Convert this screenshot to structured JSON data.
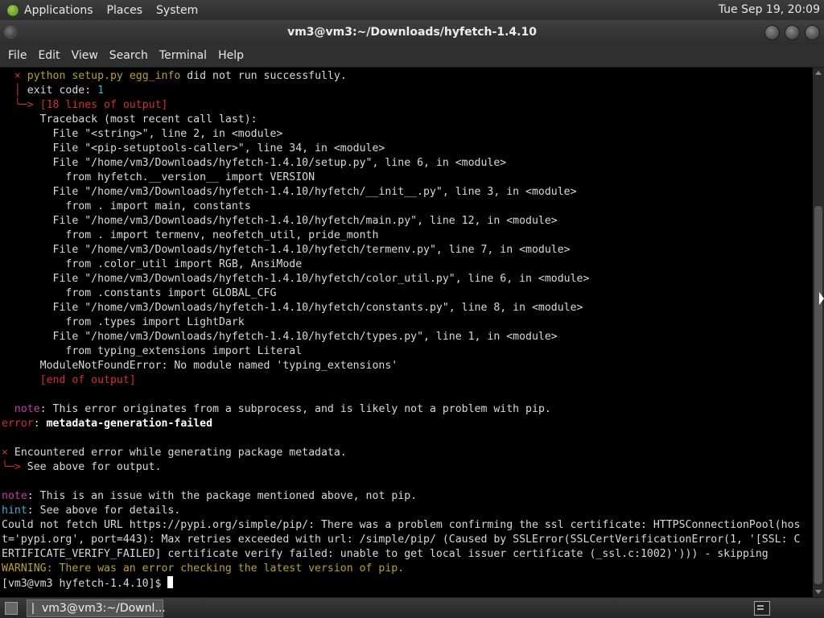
{
  "top_panel": {
    "menus": [
      "Applications",
      "Places",
      "System"
    ],
    "clock": "Tue Sep 19, 20:09"
  },
  "window": {
    "title": "vm3@vm3:~/Downloads/hyfetch-1.4.10"
  },
  "menubar": {
    "items": [
      "File",
      "Edit",
      "View",
      "Search",
      "Terminal",
      "Help"
    ]
  },
  "terminal": {
    "lines": [
      [
        {
          "t": "  "
        },
        {
          "t": "× ",
          "c": "c-red"
        },
        {
          "t": "python setup.py egg_info",
          "c": "c-yel"
        },
        {
          "t": " did not run successfully."
        }
      ],
      [
        {
          "t": "  "
        },
        {
          "t": "│",
          "c": "c-red"
        },
        {
          "t": " exit code: "
        },
        {
          "t": "1",
          "c": "c-cyan"
        }
      ],
      [
        {
          "t": "  "
        },
        {
          "t": "╰─>",
          "c": "c-red"
        },
        {
          "t": " [18 lines of output]",
          "c": "c-red"
        }
      ],
      [
        {
          "t": "      Traceback (most recent call last):"
        }
      ],
      [
        {
          "t": "        File \"<string>\", line 2, in <module>"
        }
      ],
      [
        {
          "t": "        File \"<pip-setuptools-caller>\", line 34, in <module>"
        }
      ],
      [
        {
          "t": "        File \"/home/vm3/Downloads/hyfetch-1.4.10/setup.py\", line 6, in <module>"
        }
      ],
      [
        {
          "t": "          from hyfetch.__version__ import VERSION"
        }
      ],
      [
        {
          "t": "        File \"/home/vm3/Downloads/hyfetch-1.4.10/hyfetch/__init__.py\", line 3, in <module>"
        }
      ],
      [
        {
          "t": "          from . import main, constants"
        }
      ],
      [
        {
          "t": "        File \"/home/vm3/Downloads/hyfetch-1.4.10/hyfetch/main.py\", line 12, in <module>"
        }
      ],
      [
        {
          "t": "          from . import termenv, neofetch_util, pride_month"
        }
      ],
      [
        {
          "t": "        File \"/home/vm3/Downloads/hyfetch-1.4.10/hyfetch/termenv.py\", line 7, in <module>"
        }
      ],
      [
        {
          "t": "          from .color_util import RGB, AnsiMode"
        }
      ],
      [
        {
          "t": "        File \"/home/vm3/Downloads/hyfetch-1.4.10/hyfetch/color_util.py\", line 6, in <module>"
        }
      ],
      [
        {
          "t": "          from .constants import GLOBAL_CFG"
        }
      ],
      [
        {
          "t": "        File \"/home/vm3/Downloads/hyfetch-1.4.10/hyfetch/constants.py\", line 8, in <module>"
        }
      ],
      [
        {
          "t": "          from .types import LightDark"
        }
      ],
      [
        {
          "t": "        File \"/home/vm3/Downloads/hyfetch-1.4.10/hyfetch/types.py\", line 1, in <module>"
        }
      ],
      [
        {
          "t": "          from typing_extensions import Literal"
        }
      ],
      [
        {
          "t": "      ModuleNotFoundError: No module named 'typing_extensions'"
        }
      ],
      [
        {
          "t": "      "
        },
        {
          "t": "[end of output]",
          "c": "c-red"
        }
      ],
      [
        {
          "t": ""
        }
      ],
      [
        {
          "t": "  "
        },
        {
          "t": "note",
          "c": "c-magenta"
        },
        {
          "t": ": This error originates from a subprocess, and is likely not a problem with pip."
        }
      ],
      [
        {
          "t": "error",
          "c": "c-red"
        },
        {
          "t": ": "
        },
        {
          "t": "metadata-generation-failed",
          "c": "c-bold"
        }
      ],
      [
        {
          "t": ""
        }
      ],
      [
        {
          "t": "× ",
          "c": "c-red"
        },
        {
          "t": "Encountered error while generating package metadata."
        }
      ],
      [
        {
          "t": "╰─>",
          "c": "c-red"
        },
        {
          "t": " See above for output."
        }
      ],
      [
        {
          "t": ""
        }
      ],
      [
        {
          "t": "note",
          "c": "c-magenta"
        },
        {
          "t": ": This is an issue with the package mentioned above, not pip."
        }
      ],
      [
        {
          "t": "hint",
          "c": "c-cyan"
        },
        {
          "t": ": See above for details."
        }
      ],
      [
        {
          "t": "Could not fetch URL https://pypi.org/simple/pip/: There was a problem confirming the ssl certificate: HTTPSConnectionPool(hos"
        }
      ],
      [
        {
          "t": "t='pypi.org', port=443): Max retries exceeded with url: /simple/pip/ (Caused by SSLError(SSLCertVerificationError(1, '[SSL: C"
        }
      ],
      [
        {
          "t": "ERTIFICATE_VERIFY_FAILED] certificate verify failed: unable to get local issuer certificate (_ssl.c:1002)'))) - skipping"
        }
      ],
      [
        {
          "t": "WARNING: There was an error checking the latest version of pip.",
          "c": "c-yel"
        }
      ],
      [
        {
          "t": "[vm3@vm3 hyfetch-1.4.10]$ "
        }
      ]
    ]
  },
  "taskbar": {
    "task_label": "vm3@vm3:~/Downl..."
  },
  "colors": {
    "terminal_bg": "#000000",
    "terminal_fg": "#d9d9d9",
    "error_red": "#cc3333",
    "warning_yellow": "#b9a12e",
    "hint_cyan": "#3fb3c4",
    "note_magenta": "#c43bb0"
  }
}
